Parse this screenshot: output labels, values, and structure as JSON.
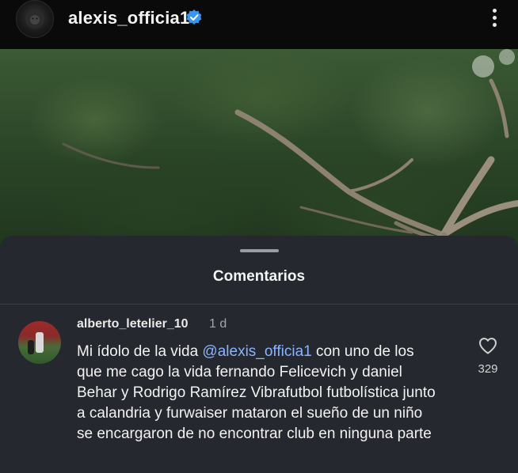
{
  "header": {
    "username": "alexis_officia1",
    "verified_icon": "verified-badge-icon",
    "more_icon": "more-options-icon"
  },
  "comments_sheet": {
    "title": "Comentarios",
    "comment": {
      "username": "alberto_letelier_10",
      "time": "1 d",
      "text_before": "Mi ídolo de la vida ",
      "mention": "@alexis_officia1",
      "text_after": " con uno de los que me cago la vida fernando Felicevich y daniel Behar y Rodrigo Ramírez Vibrafutbol futbolística junto a calandria y furwaiser mataron el sueño de un niño se encargaron de no encontrar club en ninguna parte",
      "likes": "329",
      "like_icon": "heart-icon"
    }
  },
  "colors": {
    "sheet_bg": "#25282e",
    "mention": "#8bb4ff",
    "verified": "#3897f0"
  }
}
